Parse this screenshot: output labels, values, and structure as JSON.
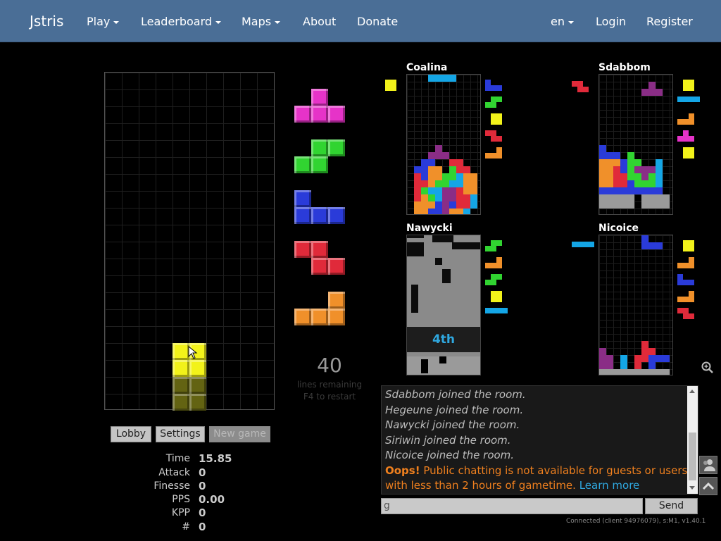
{
  "nav": {
    "brand": "Jstris",
    "items": [
      {
        "label": "Play",
        "dropdown": true
      },
      {
        "label": "Leaderboard",
        "dropdown": true
      },
      {
        "label": "Maps",
        "dropdown": true
      },
      {
        "label": "About",
        "dropdown": false
      },
      {
        "label": "Donate",
        "dropdown": false
      }
    ],
    "right": [
      {
        "label": "en",
        "dropdown": true
      },
      {
        "label": "Login",
        "dropdown": false
      },
      {
        "label": "Register",
        "dropdown": false
      }
    ]
  },
  "colors": {
    "yellow": "#f2f21a",
    "ghost": "#6e6e14",
    "magenta": "#e633c8",
    "green": "#31d431",
    "blue": "#2a3bd9",
    "red": "#e02a3a",
    "orange": "#f0902a",
    "cyan": "#14a6e6",
    "purple": "#8a2d86",
    "garbage": "#9a9a9a",
    "nav": "#4a6e96",
    "accent": "#2fa8e0"
  },
  "board": {
    "active_piece": "O",
    "ghost_piece": "O"
  },
  "queue": [
    "T",
    "S",
    "J",
    "Z",
    "L"
  ],
  "remaining": {
    "count": "40",
    "label": "lines remaining",
    "restart_hint": "F4 to restart"
  },
  "buttons": {
    "lobby": "Lobby",
    "settings": "Settings",
    "new_game": "New game"
  },
  "stats": [
    {
      "label": "Time",
      "value": "15.85"
    },
    {
      "label": "Attack",
      "value": "0"
    },
    {
      "label": "Finesse",
      "value": "0"
    },
    {
      "label": "PPS",
      "value": "0.00"
    },
    {
      "label": "KPP",
      "value": "0"
    },
    {
      "label": "#",
      "value": "0"
    }
  ],
  "opponents": [
    {
      "name": "Coalina",
      "hold": "O",
      "queue": [
        "J",
        "S",
        "O",
        "Z",
        "L"
      ],
      "status": "playing"
    },
    {
      "name": "Sdabbom",
      "hold": "Z",
      "queue": [
        "O",
        "I",
        "L",
        "T",
        "O"
      ],
      "status": "playing"
    },
    {
      "name": "Nawycki",
      "hold": "",
      "queue": [
        "S",
        "L",
        "S",
        "O",
        "I"
      ],
      "status": "finished",
      "place": "4th"
    },
    {
      "name": "Nicoice",
      "hold": "I",
      "queue": [
        "O",
        "L",
        "J",
        "L",
        "Z"
      ],
      "status": "playing"
    }
  ],
  "chat": {
    "messages": [
      "Sdabbom joined the room.",
      "Hegeune joined the room.",
      "Nawycki joined the room.",
      "Siriwin joined the room.",
      "Nicoice joined the room."
    ],
    "warning_bold": "Oops!",
    "warning_text": " Public chatting is not available for guests or users with less than 2 hours of gametime.",
    "learn_more": "Learn more",
    "input_value": "g",
    "send_label": "Send"
  },
  "status": "Connected (client 94976079), s:M1, v1.40.1"
}
